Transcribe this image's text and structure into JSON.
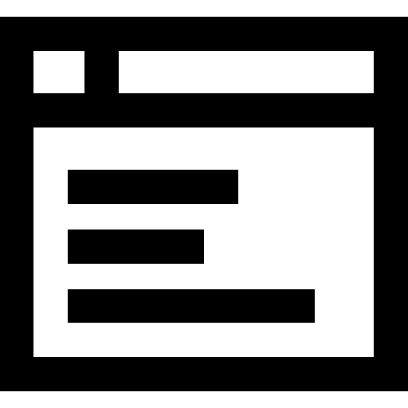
{
  "icon": {
    "name": "browser-window-icon",
    "stroke_color": "#000000",
    "fill_color": "#ffffff",
    "text_line_count": 3
  }
}
